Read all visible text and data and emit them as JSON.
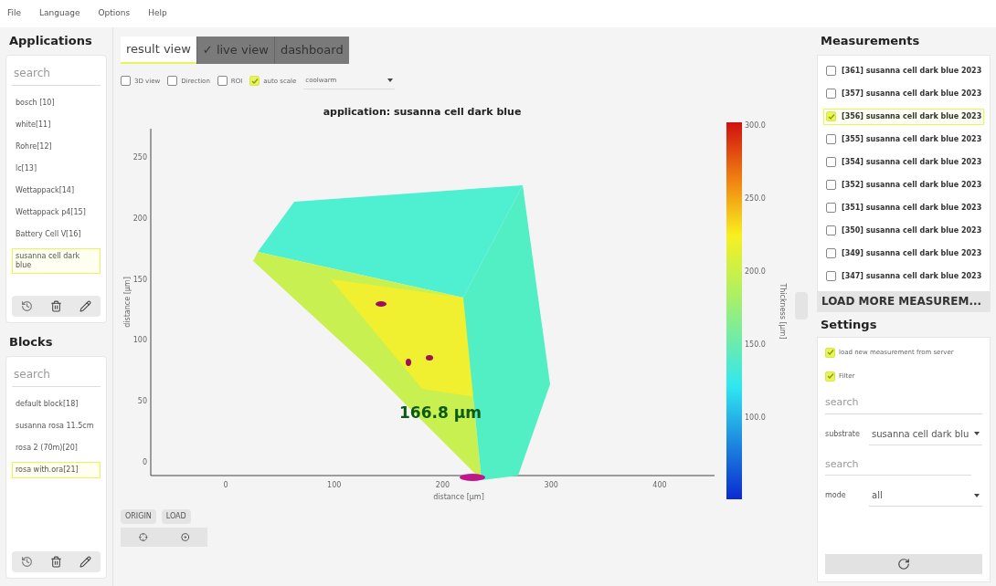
{
  "menu": [
    "File",
    "Language",
    "Options",
    "Help"
  ],
  "applications": {
    "title": "Applications",
    "search": {
      "placeholder": "search"
    },
    "items": [
      {
        "label": "bosch [10]",
        "selected": false
      },
      {
        "label": "white[11]",
        "selected": false
      },
      {
        "label": "Rohre[12]",
        "selected": false
      },
      {
        "label": "lc[13]",
        "selected": false
      },
      {
        "label": "Wettappack[14]",
        "selected": false
      },
      {
        "label": "Wettappack p4[15]",
        "selected": false
      },
      {
        "label": "Battery Cell V[16]",
        "selected": false
      },
      {
        "label": "susanna cell dark blue",
        "selected": true
      }
    ]
  },
  "blocks": {
    "title": "Blocks",
    "search": {
      "placeholder": "search"
    },
    "items": [
      {
        "label": "default block[18]",
        "selected": false
      },
      {
        "label": "susanna rosa 11.5cm",
        "selected": false
      },
      {
        "label": "rosa 2 (70m)[20]",
        "selected": false
      },
      {
        "label": "rosa with.ora[21]",
        "selected": true
      }
    ]
  },
  "tabs": [
    {
      "label": "result view",
      "selected": true
    },
    {
      "label": "✓ live view",
      "selected": false
    },
    {
      "label": "dashboard",
      "selected": false
    }
  ],
  "options": [
    {
      "label": "3D view",
      "checked": false
    },
    {
      "label": "Direction",
      "checked": false
    },
    {
      "label": "ROI",
      "checked": false
    },
    {
      "label": "auto scale",
      "checked": true
    }
  ],
  "colormap": {
    "value": "coolwarm"
  },
  "plot": {
    "title": "application: susanna cell dark blue",
    "xlabel": "distance [µm]",
    "ylabel": "distance [µm]",
    "xticks": [
      "0",
      "100",
      "200",
      "300",
      "400"
    ],
    "yticks": [
      "250",
      "200",
      "150",
      "100",
      "50",
      "0"
    ],
    "colorbar_ticks": [
      "300.0",
      "250.0",
      "200.0",
      "150.0",
      "100.0"
    ],
    "colorbar_label": "Thickness [µm]",
    "reading": "166.8 µm"
  },
  "plot_buttons": [
    "ORIGIN",
    "LOAD"
  ],
  "measurements": {
    "title": "Measurements",
    "items": [
      {
        "label": "[361] susanna cell dark blue 2023",
        "checked": false,
        "selected": false
      },
      {
        "label": "[357] susanna cell dark blue 2023",
        "checked": false,
        "selected": false
      },
      {
        "label": "[356] susanna cell dark blue 2023",
        "checked": true,
        "selected": true
      },
      {
        "label": "[355] susanna cell dark blue 2023",
        "checked": false,
        "selected": false
      },
      {
        "label": "[354] susanna cell dark blue 2023",
        "checked": false,
        "selected": false
      },
      {
        "label": "[352] susanna cell dark blue 2023",
        "checked": false,
        "selected": false
      },
      {
        "label": "[351] susanna cell dark blue 2023",
        "checked": false,
        "selected": false
      },
      {
        "label": "[350] susanna cell dark blue 2023",
        "checked": false,
        "selected": false
      },
      {
        "label": "[349] susanna cell dark blue 2023",
        "checked": false,
        "selected": false
      },
      {
        "label": "[347] susanna cell dark blue 2023",
        "checked": false,
        "selected": false
      }
    ],
    "load_more": "LOAD MORE MEASUREM..."
  },
  "settings": {
    "title": "Settings",
    "checks": [
      {
        "label": "load new measurement from server",
        "checked": true
      },
      {
        "label": "Filter",
        "checked": true
      }
    ],
    "search1": {
      "placeholder": "search"
    },
    "substrate": {
      "label": "substrate",
      "value": "susanna cell dark blu"
    },
    "search2": {
      "placeholder": "search"
    },
    "mode": {
      "label": "mode",
      "value": "all"
    }
  }
}
